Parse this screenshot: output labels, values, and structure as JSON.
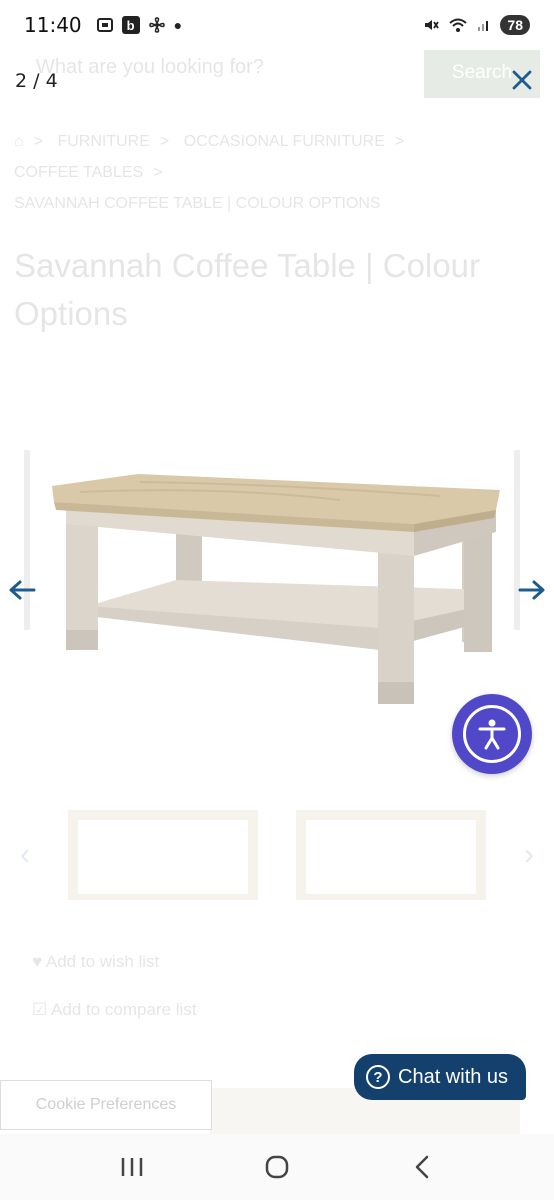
{
  "status_bar": {
    "time": "11:40",
    "battery": "78",
    "icons": [
      "screenshot-icon",
      "b-app-icon",
      "pinwheel-icon",
      "dot-icon",
      "mute-icon",
      "wifi-icon",
      "signal-icon"
    ]
  },
  "background_page": {
    "search_placeholder": "What are you looking for?",
    "search_button": "Search",
    "breadcrumbs": [
      "FURNITURE",
      "OCCASIONAL FURNITURE",
      "COFFEE TABLES",
      "SAVANNAH COFFEE TABLE | COLOUR OPTIONS"
    ],
    "product_title": "Savannah Coffee Table | Colour Options",
    "wishlist_label": "Add to wish list",
    "compare_label": "Add to compare list"
  },
  "lightbox": {
    "counter": "2 / 4",
    "close_icon": "close-icon",
    "prev_icon": "arrow-left-icon",
    "next_icon": "arrow-right-icon",
    "image_subject": "coffee-table"
  },
  "accessibility": {
    "icon": "accessibility-icon",
    "color": "#5048c9"
  },
  "chat": {
    "label": "Chat with us",
    "icon": "question-icon",
    "color": "#13406d"
  },
  "cookie": {
    "label": "Cookie Preferences"
  },
  "colors": {
    "accent": "#1e5b8e",
    "table_top": "#d9c9a9",
    "table_body": "#dcd6cc"
  }
}
